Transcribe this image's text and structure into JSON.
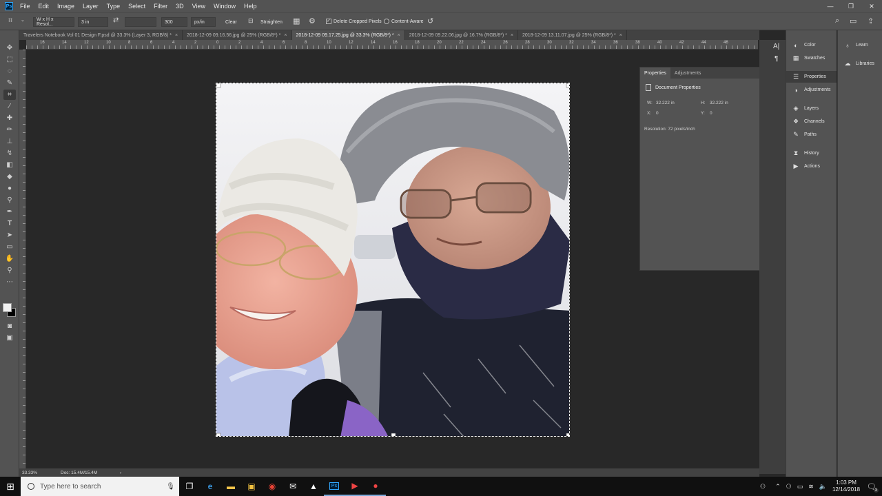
{
  "menubar": {
    "logo": "Ps",
    "items": [
      "File",
      "Edit",
      "Image",
      "Layer",
      "Type",
      "Select",
      "Filter",
      "3D",
      "View",
      "Window",
      "Help"
    ],
    "window_controls": [
      "—",
      "❐",
      "✕"
    ]
  },
  "options": {
    "ratio_select": "W x H x Resol...",
    "width_value": "3 in",
    "height_value": "",
    "resolution_value": "300",
    "resolution_unit": "px/in",
    "clear_label": "Clear",
    "straighten_label": "Straighten",
    "delete_cropped_label": "Delete Cropped Pixels",
    "content_aware_label": "Content-Aware"
  },
  "tabs": [
    {
      "label": "Travelers Notebook Vol 01 Design F.psd @ 33.3% (Layer 3, RGB/8) *",
      "active": false
    },
    {
      "label": "2018-12-09 09.16.56.jpg @ 25% (RGB/8*) *",
      "active": false
    },
    {
      "label": "2018-12-09 09.17.25.jpg @ 33.3% (RGB/8*) *",
      "active": true
    },
    {
      "label": "2018-12-09 09.22.06.jpg @ 16.7% (RGB/8*) *",
      "active": false
    },
    {
      "label": "2018-12-09 13.11.07.jpg @ 25% (RGB/8*) *",
      "active": false
    }
  ],
  "ruler_labels": [
    "16",
    "14",
    "12",
    "10",
    "8",
    "6",
    "4",
    "2",
    "0",
    "2",
    "4",
    "6",
    "8",
    "10",
    "12",
    "14",
    "16",
    "18",
    "20",
    "22",
    "24",
    "26",
    "28",
    "30",
    "32",
    "34",
    "36",
    "38",
    "40",
    "42",
    "44",
    "46"
  ],
  "status": {
    "zoom": "33.33%",
    "doc": "Doc: 15.4M/15.4M",
    "arrow": "›"
  },
  "properties": {
    "tab_properties": "Properties",
    "tab_adjustments": "Adjustments",
    "section_title": "Document Properties",
    "w_label": "W:",
    "w_value": "32.222 in",
    "h_label": "H:",
    "h_value": "32.222 in",
    "x_label": "X:",
    "x_value": "0",
    "y_label": "Y:",
    "y_value": "0",
    "resolution": "Resolution: 72 pixels/inch"
  },
  "dock1": {
    "items": [
      "Color",
      "Swatches",
      "Properties",
      "Adjustments",
      "Layers",
      "Channels",
      "Paths",
      "History",
      "Actions"
    ]
  },
  "dock2": {
    "items": [
      "Learn",
      "Libraries"
    ]
  },
  "taskbar": {
    "search_placeholder": "Type here to search",
    "time": "1:03 PM",
    "date": "12/14/2018",
    "notification_count": "3"
  }
}
